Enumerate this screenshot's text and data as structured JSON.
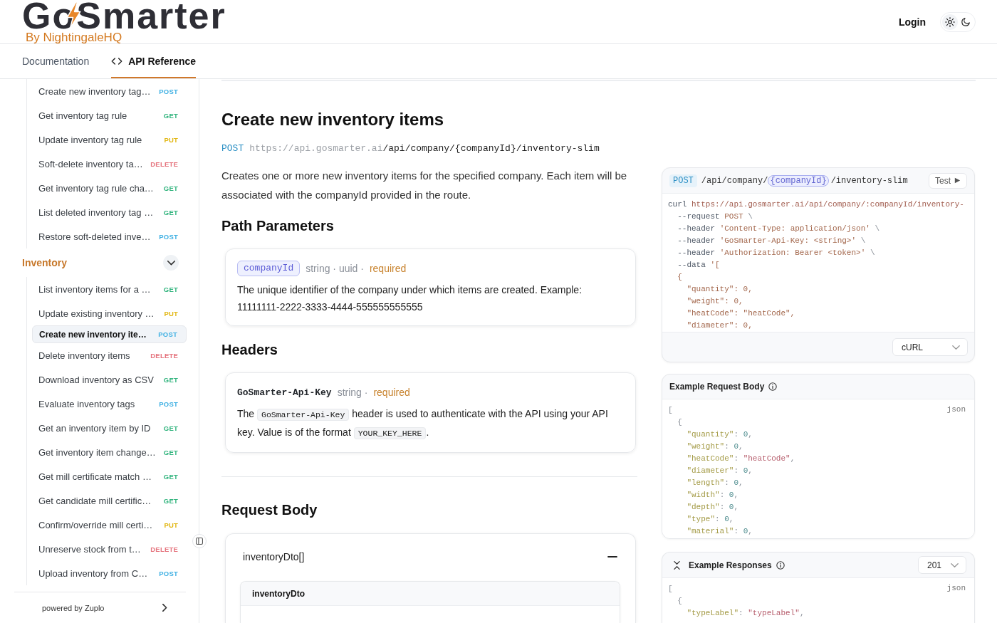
{
  "header": {
    "logo": {
      "wordmark": "GoSmarter",
      "tagline": "By NightingaleHQ"
    },
    "login": "Login",
    "theme_options": [
      {
        "kind": "light",
        "selected": true
      },
      {
        "kind": "dark",
        "selected": false
      }
    ]
  },
  "tabs": [
    {
      "label": "Documentation",
      "kind": "docs",
      "selected": false
    },
    {
      "label": "API Reference",
      "kind": "api",
      "selected": true
    }
  ],
  "sidebar": {
    "groups": [
      {
        "items": [
          {
            "label": "Create new inventory tag…",
            "method": "POST",
            "color": "#3fb0e3",
            "selected": false
          },
          {
            "label": "Get inventory tag rule",
            "method": "GET",
            "color": "#2fb37c",
            "selected": false
          },
          {
            "label": "Update inventory tag rule",
            "method": "PUT",
            "color": "#e2b714",
            "selected": false
          },
          {
            "label": "Soft-delete inventory ta…",
            "method": "DELETE",
            "color": "#e5737d",
            "selected": false
          },
          {
            "label": "Get inventory tag rule cha…",
            "method": "GET",
            "color": "#2fb37c",
            "selected": false
          },
          {
            "label": "List deleted inventory tag …",
            "method": "GET",
            "color": "#2fb37c",
            "selected": false
          },
          {
            "label": "Restore soft-deleted inve…",
            "method": "POST",
            "color": "#3fb0e3",
            "selected": false
          }
        ]
      },
      {
        "label": "Inventory",
        "expanded": true,
        "items": [
          {
            "label": "List inventory items for a …",
            "method": "GET",
            "color": "#2fb37c",
            "selected": false
          },
          {
            "label": "Update existing inventory …",
            "method": "PUT",
            "color": "#e2b714",
            "selected": false
          },
          {
            "label": "Create new inventory ite…",
            "method": "POST",
            "color": "#3fb0e3",
            "selected": true
          },
          {
            "label": "Delete inventory items",
            "method": "DELETE",
            "color": "#e5737d",
            "selected": false
          },
          {
            "label": "Download inventory as CSV",
            "method": "GET",
            "color": "#2fb37c",
            "selected": false
          },
          {
            "label": "Evaluate inventory tags",
            "method": "POST",
            "color": "#3fb0e3",
            "selected": false
          },
          {
            "label": "Get an inventory item by ID",
            "method": "GET",
            "color": "#2fb37c",
            "selected": false
          },
          {
            "label": "Get inventory item change…",
            "method": "GET",
            "color": "#2fb37c",
            "selected": false
          },
          {
            "label": "Get mill certificate match …",
            "method": "GET",
            "color": "#2fb37c",
            "selected": false
          },
          {
            "label": "Get candidate mill certific…",
            "method": "GET",
            "color": "#2fb37c",
            "selected": false
          },
          {
            "label": "Confirm/override mill certi…",
            "method": "PUT",
            "color": "#e2b714",
            "selected": false
          },
          {
            "label": "Unreserve stock from t…",
            "method": "DELETE",
            "color": "#e5737d",
            "selected": false
          },
          {
            "label": "Upload inventory from C…",
            "method": "POST",
            "color": "#3fb0e3",
            "selected": false
          }
        ]
      }
    ],
    "footer": "powered by Zuplo"
  },
  "operation": {
    "title": "Create new inventory items",
    "method": "POST",
    "base_url": "https://api.gosmarter.ai",
    "path": "/api/company/{companyId}/inventory-slim",
    "description": "Creates one or more new inventory items for the specified company. Each item will be associated with the companyId provided in the route.",
    "path_parameters": {
      "heading": "Path Parameters",
      "params": [
        {
          "name": "companyId",
          "type_info": "string · uuid ·",
          "required_label": "required",
          "description": [
            {
              "kind": "text",
              "text": "The unique identifier of the company under which items are created. Example: 11111111-2222-3333-4444-555555555555"
            }
          ]
        }
      ]
    },
    "headers": {
      "heading": "Headers",
      "params": [
        {
          "name": "GoSmarter-Api-Key",
          "type_info": "string ·",
          "required_label": "required",
          "description": [
            {
              "kind": "text",
              "text": "The "
            },
            {
              "kind": "code",
              "text": "GoSmarter-Api-Key"
            },
            {
              "kind": "text",
              "text": " header is used to authenticate with the API using your API key. Value is of the format "
            },
            {
              "kind": "code",
              "text": "YOUR_KEY_HERE"
            },
            {
              "kind": "text",
              "text": "."
            }
          ]
        }
      ]
    },
    "request_body": {
      "heading": "Request Body",
      "label": "inventoryDto[]",
      "expanded": true,
      "schema_title": "inventoryDto"
    }
  },
  "request_example": {
    "method": "POST",
    "path": [
      {
        "kind": "text",
        "text": "/api/company/"
      },
      {
        "kind": "param",
        "text": "{companyId}"
      },
      {
        "kind": "text",
        "text": "/inventory-slim"
      }
    ],
    "test_label": "Test",
    "code": {
      "kind": "shell",
      "lines": [
        "curl https://api.gosmarter.ai/api/company/:companyId/inventory-",
        "  --request POST \\",
        "  --header 'Content-Type: application/json' \\",
        "  --header 'GoSmarter-Api-Key: <string>' \\",
        "  --header 'Authorization: Bearer <token>' \\",
        "  --data '[",
        "  {",
        "    \"quantity\": 0,",
        "    \"weight\": 0,",
        "    \"heatCode\": \"heatCode\",",
        "    \"diameter\": 0,"
      ]
    },
    "language_select": "cURL"
  },
  "request_body_example": {
    "title": "Example Request Body",
    "code": {
      "kind": "json",
      "label": "json",
      "lines": [
        "[",
        "  {",
        "    \"quantity\": 0,",
        "    \"weight\": 0,",
        "    \"heatCode\": \"heatCode\",",
        "    \"diameter\": 0,",
        "    \"length\": 0,",
        "    \"width\": 0,",
        "    \"depth\": 0,",
        "    \"type\": 0,",
        "    \"material\": 0,"
      ]
    }
  },
  "response_example": {
    "title": "Example Responses",
    "status_select": "201",
    "code": {
      "kind": "json",
      "label": "json",
      "lines": [
        "[",
        "  {",
        "    \"typeLabel\": \"typeLabel\","
      ]
    }
  }
}
